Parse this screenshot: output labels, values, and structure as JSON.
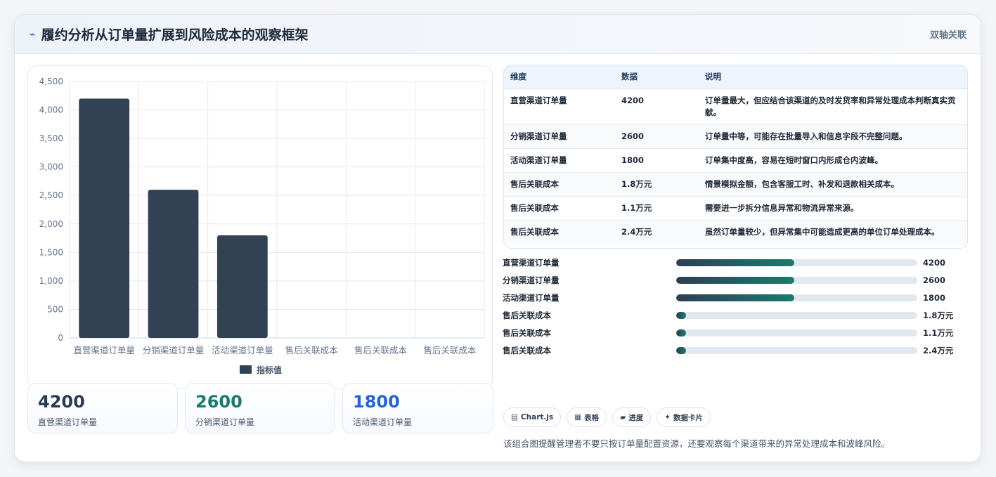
{
  "header": {
    "title": "履约分析从订单量扩展到风险成本的观察框架",
    "icon": "trend-line-icon",
    "badge": "双轴关联"
  },
  "chart_data": {
    "type": "bar",
    "categories": [
      "直营渠道订单量",
      "分销渠道订单量",
      "活动渠道订单量",
      "售后关联成本",
      "售后关联成本",
      "售后关联成本"
    ],
    "series": [
      {
        "name": "指标值",
        "values": [
          4200,
          2600,
          1800,
          0,
          0,
          0
        ],
        "color": "#334155"
      }
    ],
    "ylim": [
      0,
      4500
    ],
    "yticks": [
      "4,500",
      "4,000",
      "3,500",
      "3,000",
      "2,500",
      "2,000",
      "1,500",
      "1,000",
      "500",
      "0"
    ],
    "ytick_values": [
      4500,
      4000,
      3500,
      3000,
      2500,
      2000,
      1500,
      1000,
      500,
      0
    ],
    "grid": true,
    "legend": "bottom"
  },
  "kpis": [
    {
      "value": "4200",
      "label": "直营渠道订单量",
      "color": "#2b3a50"
    },
    {
      "value": "2600",
      "label": "分销渠道订单量",
      "color": "#1b7a6e"
    },
    {
      "value": "1800",
      "label": "活动渠道订单量",
      "color": "#2463d8"
    }
  ],
  "table": {
    "headers": [
      "维度",
      "数据",
      "说明"
    ],
    "rows": [
      [
        "直营渠道订单量",
        "4200",
        "订单量最大，但应结合该渠道的及时发货率和异常处理成本判断真实贡献。"
      ],
      [
        "分销渠道订单量",
        "2600",
        "订单量中等，可能存在批量导入和信息字段不完整问题。"
      ],
      [
        "活动渠道订单量",
        "1800",
        "订单集中度高，容易在短时窗口内形成仓内波峰。"
      ],
      [
        "售后关联成本",
        "1.8万元",
        "情景模拟金额，包含客服工时、补发和退款相关成本。"
      ],
      [
        "售后关联成本",
        "1.1万元",
        "需要进一步拆分信息异常和物流异常来源。"
      ],
      [
        "售后关联成本",
        "2.4万元",
        "虽然订单量较少，但异常集中可能造成更高的单位订单处理成本。"
      ]
    ]
  },
  "progress": [
    {
      "label": "直营渠道订单量",
      "value": "4200",
      "fraction": 0.49
    },
    {
      "label": "分销渠道订单量",
      "value": "2600",
      "fraction": 0.49
    },
    {
      "label": "活动渠道订单量",
      "value": "1800",
      "fraction": 0.49
    },
    {
      "label": "售后关联成本",
      "value": "1.8万元",
      "fraction": 0.04
    },
    {
      "label": "售后关联成本",
      "value": "1.1万元",
      "fraction": 0.04
    },
    {
      "label": "售后关联成本",
      "value": "2.4万元",
      "fraction": 0.04
    }
  ],
  "chips": [
    {
      "icon": "chart-icon",
      "glyph": "▤",
      "label": "Chart.js"
    },
    {
      "icon": "table-icon",
      "glyph": "▦",
      "label": "表格"
    },
    {
      "icon": "progress-icon",
      "glyph": "▰",
      "label": "进度"
    },
    {
      "icon": "sparkle-icon",
      "glyph": "✦",
      "label": "数据卡片"
    }
  ],
  "note": "该组合图提醒管理者不要只按订单量配置资源，还要观察每个渠道带来的异常处理成本和波峰风险。"
}
